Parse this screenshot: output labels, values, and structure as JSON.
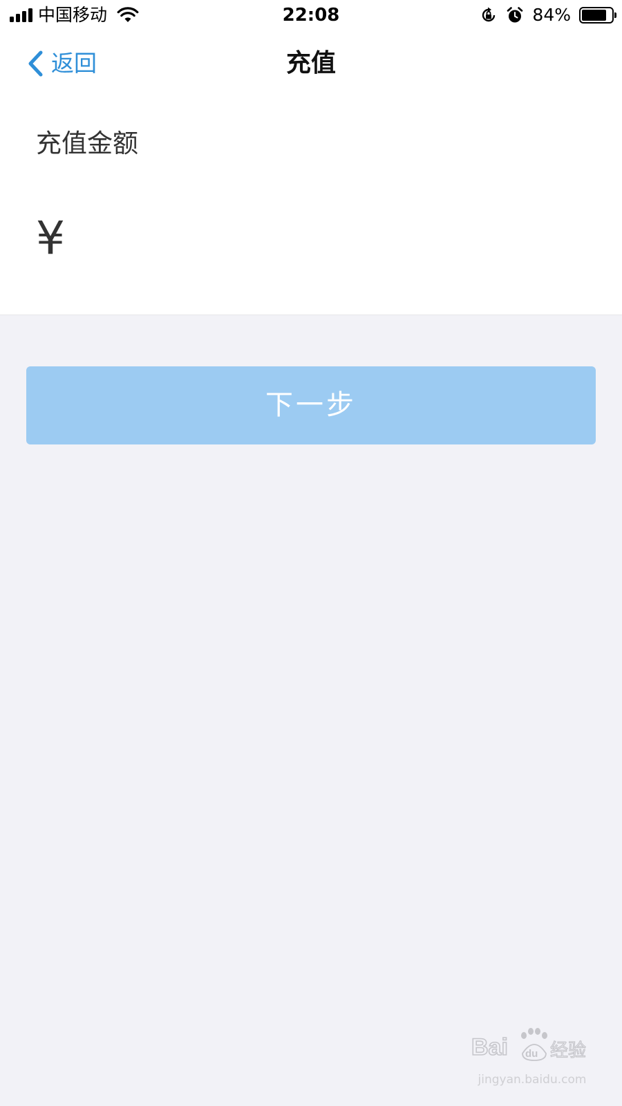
{
  "status_bar": {
    "carrier": "中国移动",
    "time": "22:08",
    "battery_percent": "84%",
    "battery_level": 0.84,
    "signal_bars": 4,
    "icons": [
      "signal-icon",
      "wifi-icon",
      "rotation-lock-icon",
      "alarm-icon",
      "battery-icon"
    ]
  },
  "nav": {
    "back_label": "返回",
    "title": "充值",
    "accent_color": "#2f8fd8"
  },
  "form": {
    "amount_label": "充值金额",
    "currency_symbol": "¥",
    "amount_value": "",
    "amount_placeholder": ""
  },
  "actions": {
    "next_label": "下一步",
    "next_color": "#9ccbf2"
  },
  "watermark": {
    "logo_text": "Bai du 经验",
    "url": "jingyan.baidu.com"
  }
}
